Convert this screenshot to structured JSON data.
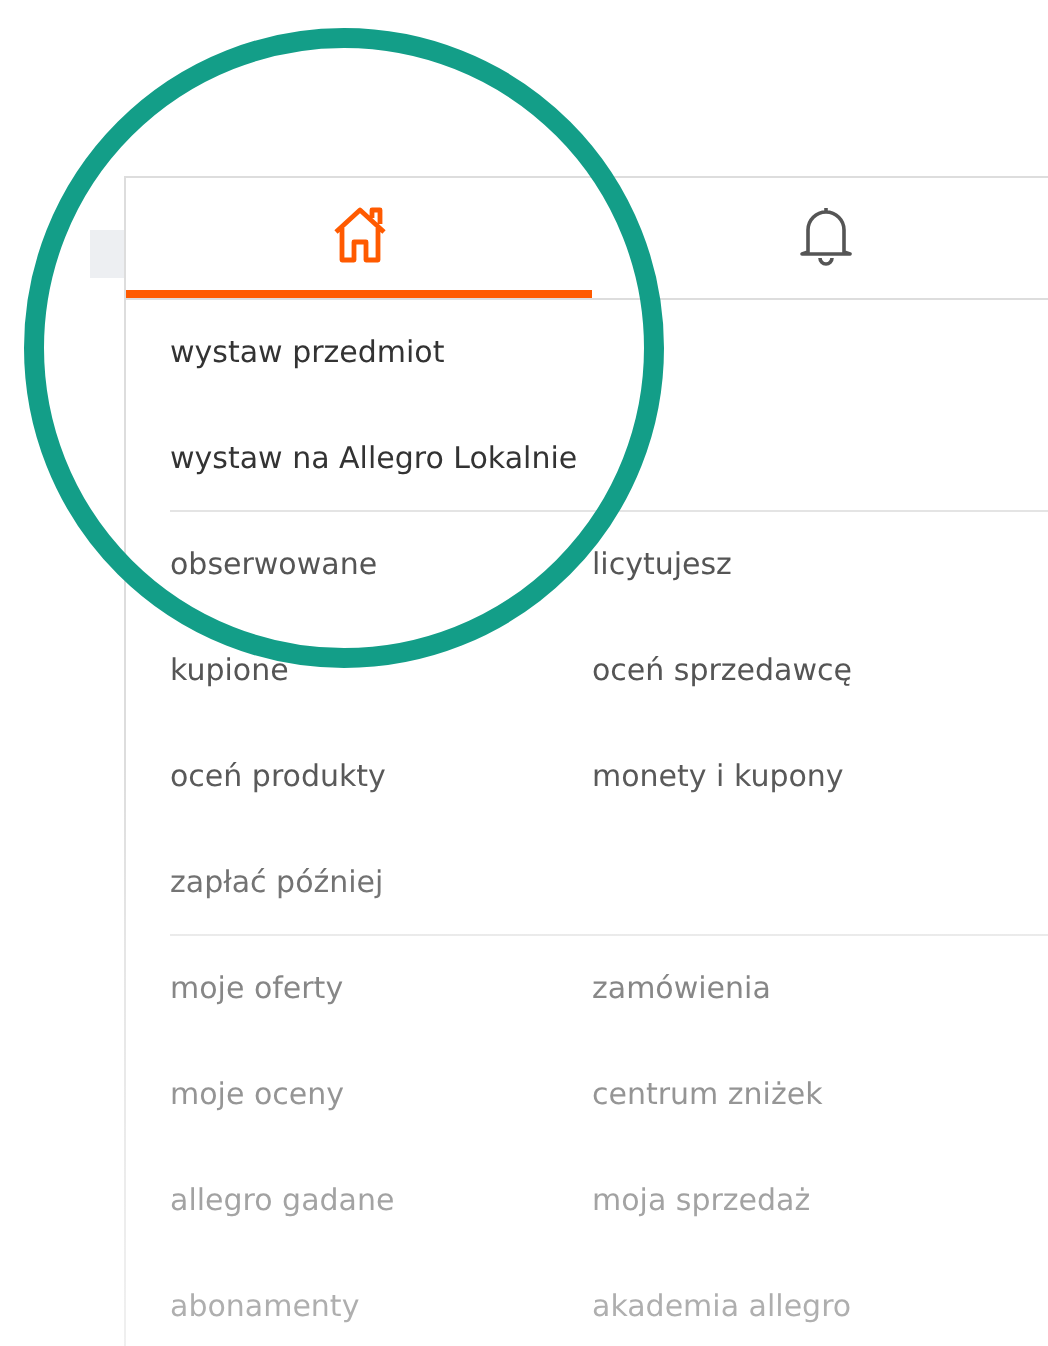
{
  "tabs": [
    {
      "kind": "home",
      "selected": true
    },
    {
      "kind": "bell",
      "selected": false
    }
  ],
  "sections": [
    {
      "kind": "list",
      "items": [
        "wystaw przedmiot",
        "wystaw na Allegro Lokalnie"
      ]
    },
    {
      "kind": "grid",
      "items": [
        "obserwowane",
        "licytujesz",
        "kupione",
        "oceń sprzedawcę",
        "oceń produkty",
        "monety i kupony",
        "zapłać później"
      ]
    },
    {
      "kind": "grid",
      "items": [
        "moje oferty",
        "zamówienia",
        "moje oceny",
        "centrum zniżek",
        "allegro gadane",
        "moja sprzedaż",
        "abonamenty",
        "akademia allegro"
      ]
    }
  ]
}
